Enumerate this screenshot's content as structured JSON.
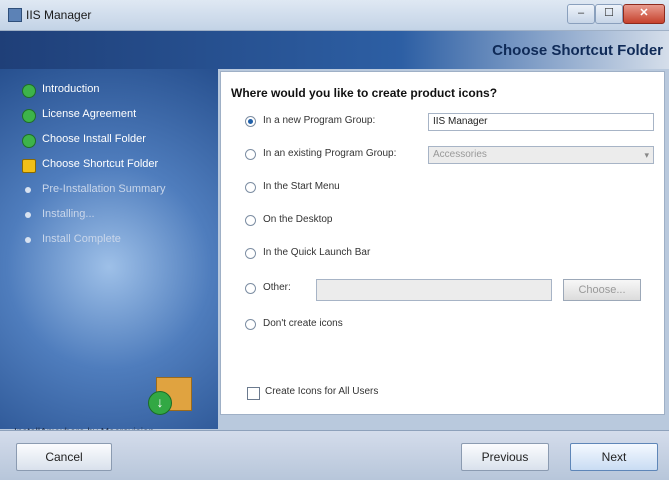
{
  "window": {
    "title": "IIS Manager",
    "min_glyph": "–",
    "max_glyph": "☐",
    "close_glyph": "✕"
  },
  "header": {
    "title": "Choose Shortcut Folder"
  },
  "sidebar": {
    "steps": [
      {
        "label": "Introduction",
        "state": "done"
      },
      {
        "label": "License Agreement",
        "state": "done"
      },
      {
        "label": "Choose Install Folder",
        "state": "done"
      },
      {
        "label": "Choose Shortcut Folder",
        "state": "current"
      },
      {
        "label": "Pre-Installation Summary",
        "state": "todo"
      },
      {
        "label": "Installing...",
        "state": "todo"
      },
      {
        "label": "Install Complete",
        "state": "todo"
      }
    ],
    "footer_text": "InstallAnywhere by Macrovision"
  },
  "main": {
    "question": "Where would you like to create product icons?",
    "options": [
      {
        "label": "In a new Program Group:",
        "checked": true
      },
      {
        "label": "In an existing Program Group:",
        "checked": false
      },
      {
        "label": "In the Start Menu",
        "checked": false
      },
      {
        "label": "On the Desktop",
        "checked": false
      },
      {
        "label": "In the Quick Launch Bar",
        "checked": false
      },
      {
        "label": "Other:",
        "checked": false
      },
      {
        "label": "Don't create icons",
        "checked": false
      }
    ],
    "new_group_value": "IIS Manager",
    "existing_group_value": "Accessories",
    "other_value": "",
    "choose_label": "Choose...",
    "all_users_label": "Create Icons for All Users",
    "all_users_checked": false
  },
  "footer": {
    "cancel_label": "Cancel",
    "previous_label": "Previous",
    "next_label": "Next"
  }
}
